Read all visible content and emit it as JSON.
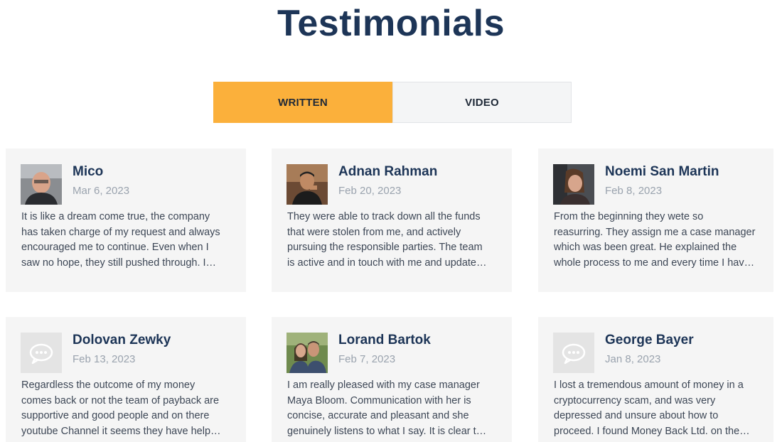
{
  "page": {
    "title": "Testimonials"
  },
  "tabs": [
    {
      "label": "WRITTEN",
      "active": true
    },
    {
      "label": "VIDEO",
      "active": false
    }
  ],
  "colors": {
    "accent": "#fbb03b",
    "heading": "#1d3557",
    "card_bg": "#f5f5f5",
    "date": "#9aa3ae"
  },
  "testimonials": [
    {
      "name": "Mico",
      "date": "Mar 6, 2023",
      "avatar": "photo",
      "lines": [
        "It is like a dream come true, the company",
        "has taken charge of my request and always",
        "encouraged me to continue. Even when I",
        "saw no hope, they still pushed through. I…"
      ]
    },
    {
      "name": "Adnan Rahman",
      "date": "Feb 20, 2023",
      "avatar": "photo",
      "lines": [
        "They were able to track down all the funds",
        "that were stolen from me, and actively",
        "pursuing the responsible parties. The team",
        "is active and in touch with me and update…"
      ]
    },
    {
      "name": "Noemi San Martin",
      "date": "Feb 8, 2023",
      "avatar": "photo",
      "lines": [
        "From the beginning they wete so",
        "reasurring. They assign me a case manager",
        "which was been great. He explained the",
        "whole process to me and every time I hav…"
      ]
    },
    {
      "name": "Dolovan Zewky",
      "date": "Feb 13, 2023",
      "avatar": "chat-bubble-icon",
      "lines": [
        "Regardless the outcome of my money",
        "comes back or not the team of payback are",
        "supportive and good people and on there",
        "youtube Channel it seems they have help…"
      ]
    },
    {
      "name": "Lorand Bartok",
      "date": "Feb 7, 2023",
      "avatar": "photo",
      "lines": [
        "I am really pleased with my case manager",
        "Maya Bloom. Communication with her is",
        "concise, accurate and pleasant and she",
        "genuinely listens to what I say. It is clear t…"
      ]
    },
    {
      "name": "George Bayer",
      "date": "Jan 8, 2023",
      "avatar": "chat-bubble-icon",
      "lines": [
        "I lost a tremendous amount of money in a",
        "cryptocurrency scam, and was very",
        "depressed and unsure about how to",
        "proceed. I found Money Back Ltd. on the…"
      ]
    }
  ]
}
